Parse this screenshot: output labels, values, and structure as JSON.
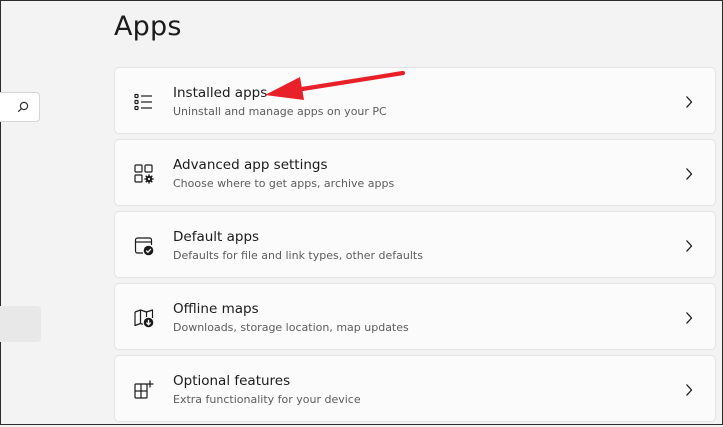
{
  "page": {
    "title": "Apps"
  },
  "cards": [
    {
      "title": "Installed apps",
      "description": "Uninstall and manage apps on your PC",
      "icon": "list-icon"
    },
    {
      "title": "Advanced app settings",
      "description": "Choose where to get apps, archive apps",
      "icon": "app-settings-icon"
    },
    {
      "title": "Default apps",
      "description": "Defaults for file and link types, other defaults",
      "icon": "default-apps-icon"
    },
    {
      "title": "Offline maps",
      "description": "Downloads, storage location, map updates",
      "icon": "map-icon"
    },
    {
      "title": "Optional features",
      "description": "Extra functionality for your device",
      "icon": "optional-features-icon"
    }
  ],
  "sidebar": {
    "search_icon": "search-icon"
  },
  "colors": {
    "background": "#f3f3f3",
    "card": "#fbfbfb",
    "card_border": "#e3e3e3",
    "annotation_arrow": "#e8202a"
  }
}
